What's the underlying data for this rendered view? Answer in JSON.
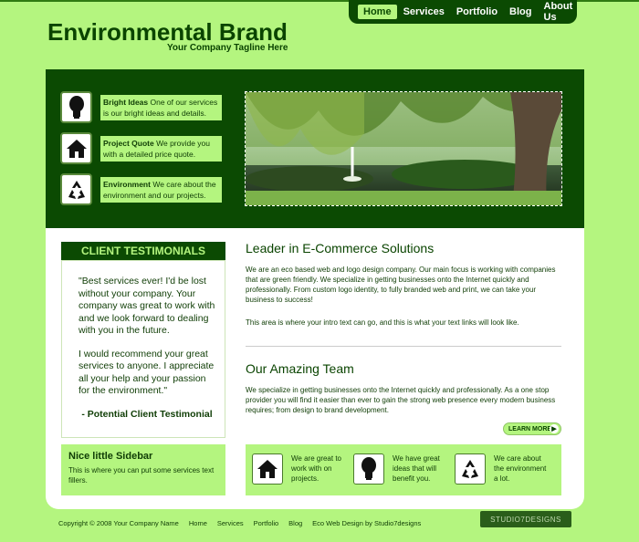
{
  "nav": {
    "items": [
      "Home",
      "Services",
      "Portfolio",
      "Blog",
      "About Us"
    ],
    "active": "Home"
  },
  "brand": {
    "name": "Environmental Brand",
    "tagline": "Your Company Tagline Here"
  },
  "features": [
    {
      "icon": "lightbulb-icon",
      "title": "Bright Ideas",
      "text": "One of our services is our bright ideas and details."
    },
    {
      "icon": "house-icon",
      "title": "Project Quote",
      "text": "We provide you with a detailed price quote."
    },
    {
      "icon": "recycle-icon",
      "title": "Environment",
      "text": "We care about the environment and our projects."
    }
  ],
  "testimonials": {
    "heading": "CLIENT TESTIMONIALS",
    "quote1": "\"Best services ever! I'd be lost without your company. Your company was great to work with and we look forward to dealing with you in the future.",
    "quote2": "I would recommend your great services to anyone. I appreciate all your help and your passion for the environment.\"",
    "signature": "- Potential Client Testimonial"
  },
  "sidebar": {
    "title": "Nice little Sidebar",
    "text": "This is where you can put some services text fillers."
  },
  "intro": {
    "heading": "Leader in E-Commerce Solutions",
    "p1": "We are an eco based web and logo design company. Our main focus is working with companies that are green friendly. We specialize in getting businesses onto the Internet quickly and professionally. From custom logo identity, to fully branded web and print, we can take your business to success!",
    "p2": "This area is where your intro text can go, and this is what your text links will look like."
  },
  "team": {
    "heading": "Our Amazing Team",
    "p": "We specialize in getting businesses onto the Internet quickly and professionally. As a one stop provider you will find it easier than ever to gain the strong web presence every modern business requires; from design to brand development."
  },
  "learn_more": "LEARN MORE",
  "services": [
    {
      "icon": "house-icon",
      "text": "We are great to work with on projects."
    },
    {
      "icon": "lightbulb-icon",
      "text": "We have great ideas that will benefit you."
    },
    {
      "icon": "recycle-icon",
      "text": "We care about the environment a lot."
    }
  ],
  "footer": {
    "copyright": "Copyright © 2008 Your Company Name",
    "links": [
      "Home",
      "Services",
      "Portfolio",
      "Blog"
    ],
    "credit": "Eco Web Design by Studio7designs",
    "stamp": "STUDIO7DESIGNS"
  },
  "colors": {
    "background": "#b4f57f",
    "dark_green": "#0b4a02",
    "white": "#ffffff"
  }
}
